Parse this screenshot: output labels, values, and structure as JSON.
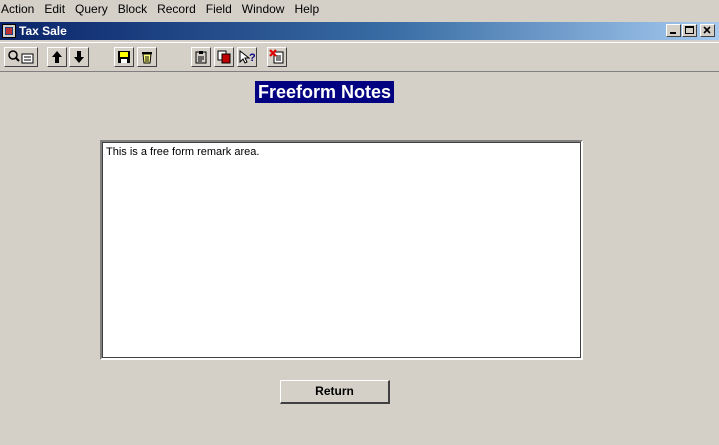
{
  "menubar": {
    "items": [
      "Action",
      "Edit",
      "Query",
      "Block",
      "Record",
      "Field",
      "Window",
      "Help"
    ]
  },
  "window": {
    "title": "Tax Sale",
    "title_gradient": [
      "#0a246a",
      "#a6caf0"
    ]
  },
  "toolbar": {
    "buttons": [
      {
        "name": "enter-query-icon"
      },
      {
        "name": "arrow-up-icon"
      },
      {
        "name": "arrow-down-icon"
      },
      {
        "name": "save-icon"
      },
      {
        "name": "trash-icon"
      },
      {
        "name": "clipboard-icon"
      },
      {
        "name": "copy-icon"
      },
      {
        "name": "help-icon"
      },
      {
        "name": "exit-icon"
      }
    ]
  },
  "form": {
    "heading": "Freeform Notes",
    "notes_text": "This is a free form remark area.",
    "return_label": "Return"
  }
}
